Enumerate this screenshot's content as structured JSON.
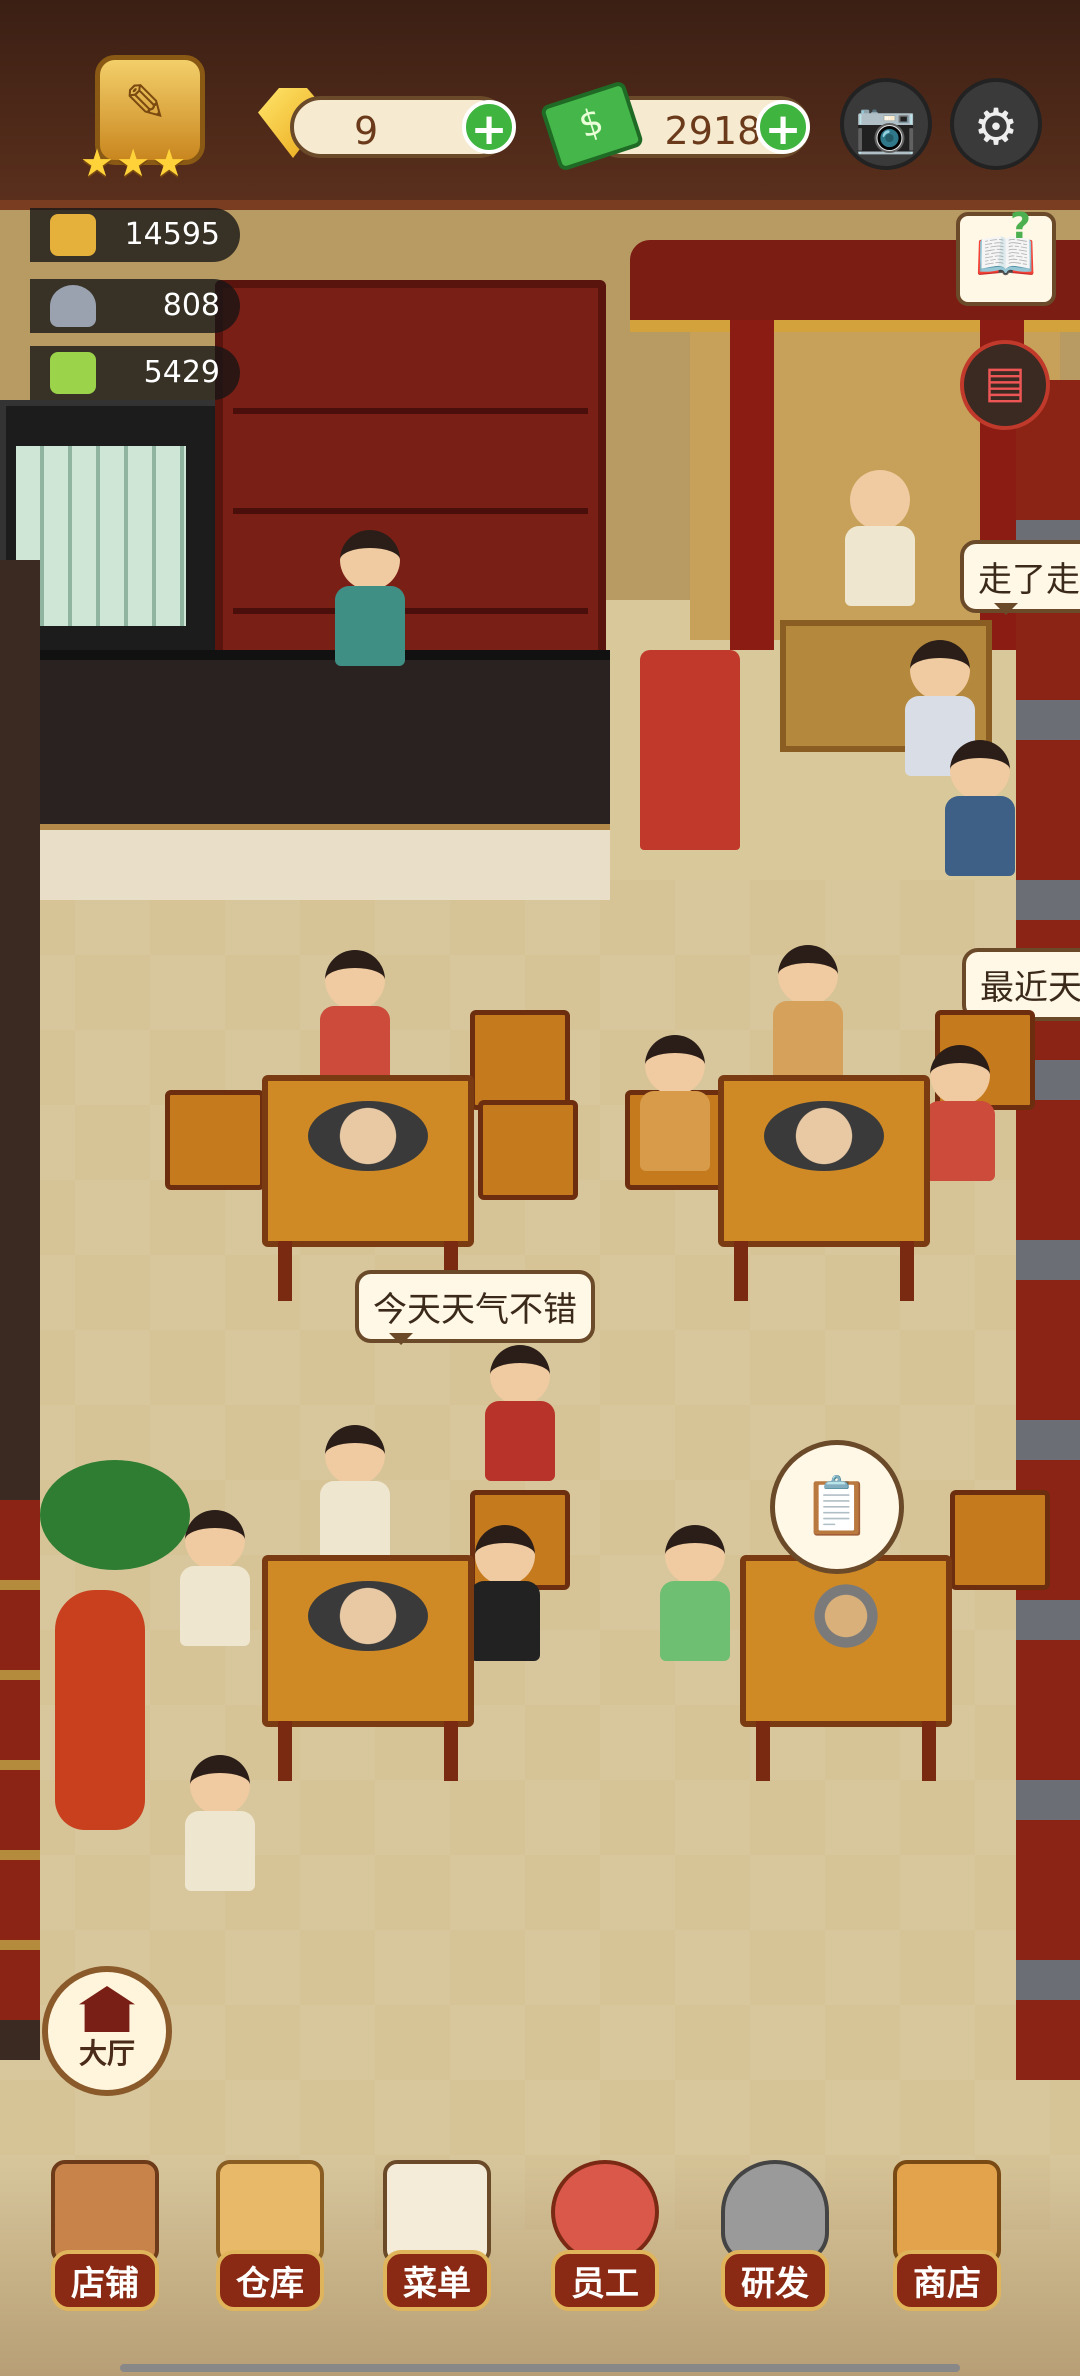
{
  "hud": {
    "gems": "9",
    "cash": "29181",
    "plus_symbol": "+",
    "stars": "★★★"
  },
  "stats": [
    {
      "icon": "hotpot-icon",
      "value": "14595"
    },
    {
      "icon": "cloche-icon",
      "value": "808"
    },
    {
      "icon": "menu-book-icon",
      "value": "5429"
    }
  ],
  "bubbles": {
    "right_top": "走了走",
    "right_mid": "最近天",
    "center": "今天天气不错"
  },
  "hall_button": {
    "label": "大厅"
  },
  "tabs": [
    {
      "label": "店铺",
      "icon": "shop-front-icon"
    },
    {
      "label": "仓库",
      "icon": "warehouse-boxes-icon"
    },
    {
      "label": "菜单",
      "icon": "clipboard-menu-icon"
    },
    {
      "label": "员工",
      "icon": "staff-icon"
    },
    {
      "label": "研发",
      "icon": "wok-research-icon"
    },
    {
      "label": "商店",
      "icon": "store-icon"
    }
  ],
  "icons": {
    "camera": "camera-icon",
    "settings": "gear-icon",
    "guide": "book-question-icon",
    "recipe": "red-book-icon",
    "order": "clipboard-order-icon"
  },
  "colors": {
    "accent_green": "#3fb43f",
    "tab_red": "#8a2a14",
    "pill_cream": "#f6ead0"
  }
}
